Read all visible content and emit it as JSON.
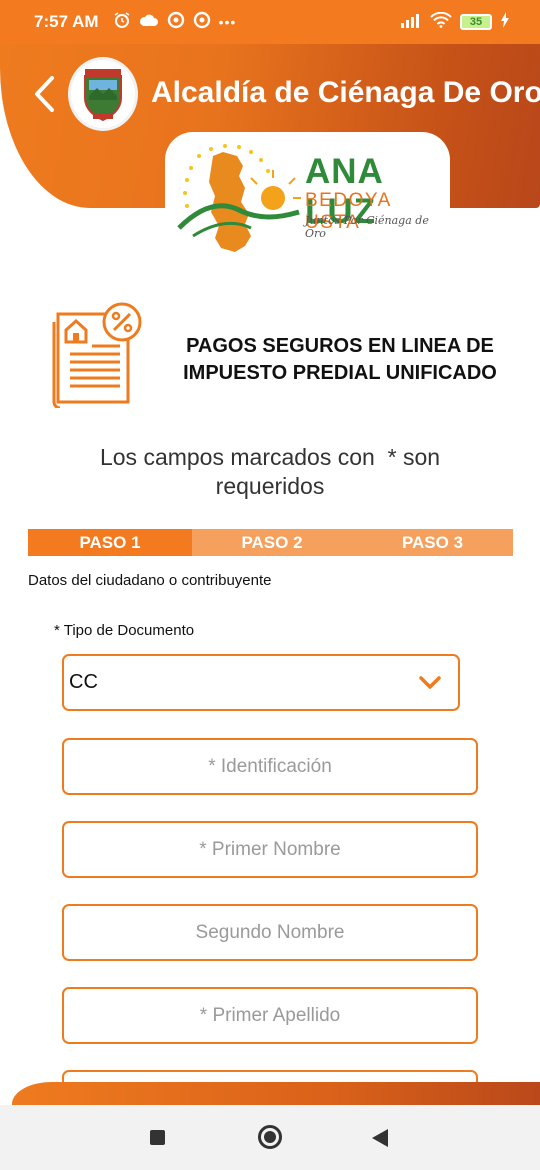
{
  "status_bar": {
    "time": "7:57 AM",
    "dots": "•••",
    "battery": "35",
    "icons": [
      "alarm-icon",
      "cloud-icon",
      "sync-icon",
      "sync-icon",
      "signal-icon",
      "wifi-icon",
      "battery-icon",
      "charging-icon"
    ]
  },
  "header": {
    "title": "Alcaldía de Ciénaga De Oro",
    "back_icon": "chevron-left-icon"
  },
  "brand": {
    "name": "ANA LUZ",
    "surname": "BEDOYA USTA",
    "slogan": "Juntos Por Ciénaga de Oro"
  },
  "main": {
    "heading_line1": "PAGOS SEGUROS EN LINEA DE",
    "heading_line2": "IMPUESTO PREDIAL UNIFICADO",
    "required_note_line1": "Los campos marcados con  * son",
    "required_note_line2": "requeridos"
  },
  "steps": [
    {
      "label": "PASO 1",
      "active": true
    },
    {
      "label": "PASO 2",
      "active": false
    },
    {
      "label": "PASO 3",
      "active": false
    }
  ],
  "form": {
    "section_label": "Datos del ciudadano o contribuyente",
    "doc_type_label": "* Tipo de Documento",
    "doc_type_value": "CC",
    "fields": {
      "identificacion": "* Identificación",
      "primer_nombre": "* Primer Nombre",
      "segundo_nombre": "Segundo Nombre",
      "primer_apellido": "* Primer Apellido"
    }
  },
  "colors": {
    "accent": "#f47a20",
    "accent_light": "#f5a05d",
    "brand_green": "#2f8a3a"
  }
}
